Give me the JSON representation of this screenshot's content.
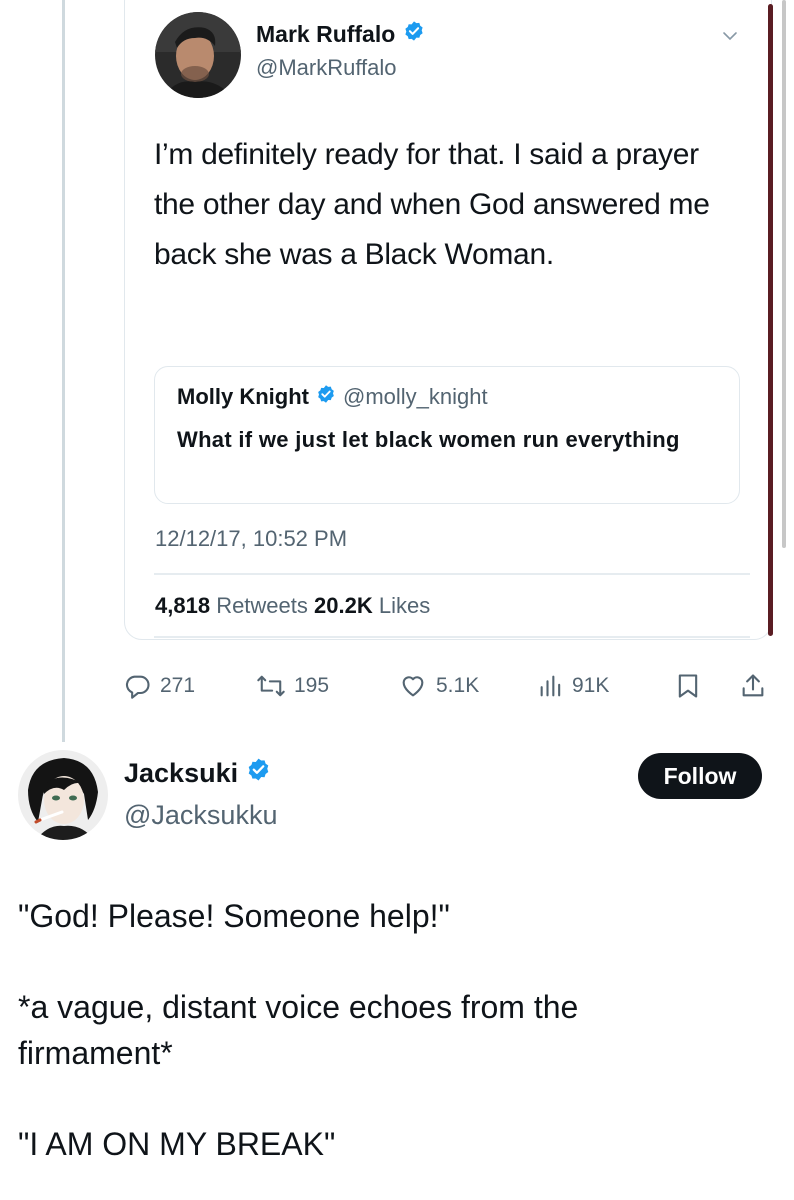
{
  "quoted_tweet": {
    "author": {
      "name": "Mark Ruffalo",
      "handle": "@MarkRuffalo",
      "verified": true
    },
    "text": "I’m definitely ready for that. I said a prayer the other day and when God answered me back she was a Black Woman.",
    "quote": {
      "author_name": "Molly Knight",
      "author_handle": "@molly_knight",
      "text": "What if we just let black women run everything"
    },
    "timestamp": "12/12/17, 10:52 PM",
    "stats": {
      "retweets_count": "4,818",
      "retweets_label": "Retweets",
      "likes_count": "20.2K",
      "likes_label": "Likes"
    }
  },
  "actions": {
    "replies": "271",
    "reposts": "195",
    "likes": "5.1K",
    "views": "91K"
  },
  "post": {
    "author": {
      "name": "Jacksuki",
      "handle": "@Jacksukku",
      "verified": true
    },
    "follow_label": "Follow",
    "paragraphs": [
      "\"God! Please! Someone help!\"",
      "*a vague, distant voice echoes from the firmament*",
      "\"I AM ON MY BREAK\""
    ]
  },
  "colors": {
    "verified_badge": "#1d9bf0",
    "muted_text": "#536471",
    "primary_text": "#0f1419",
    "follow_button_bg": "#0f1419"
  },
  "icons": [
    "chevron-down-icon",
    "verified-badge-icon",
    "reply-icon",
    "repost-icon",
    "like-icon",
    "views-icon",
    "bookmark-icon",
    "share-icon"
  ]
}
